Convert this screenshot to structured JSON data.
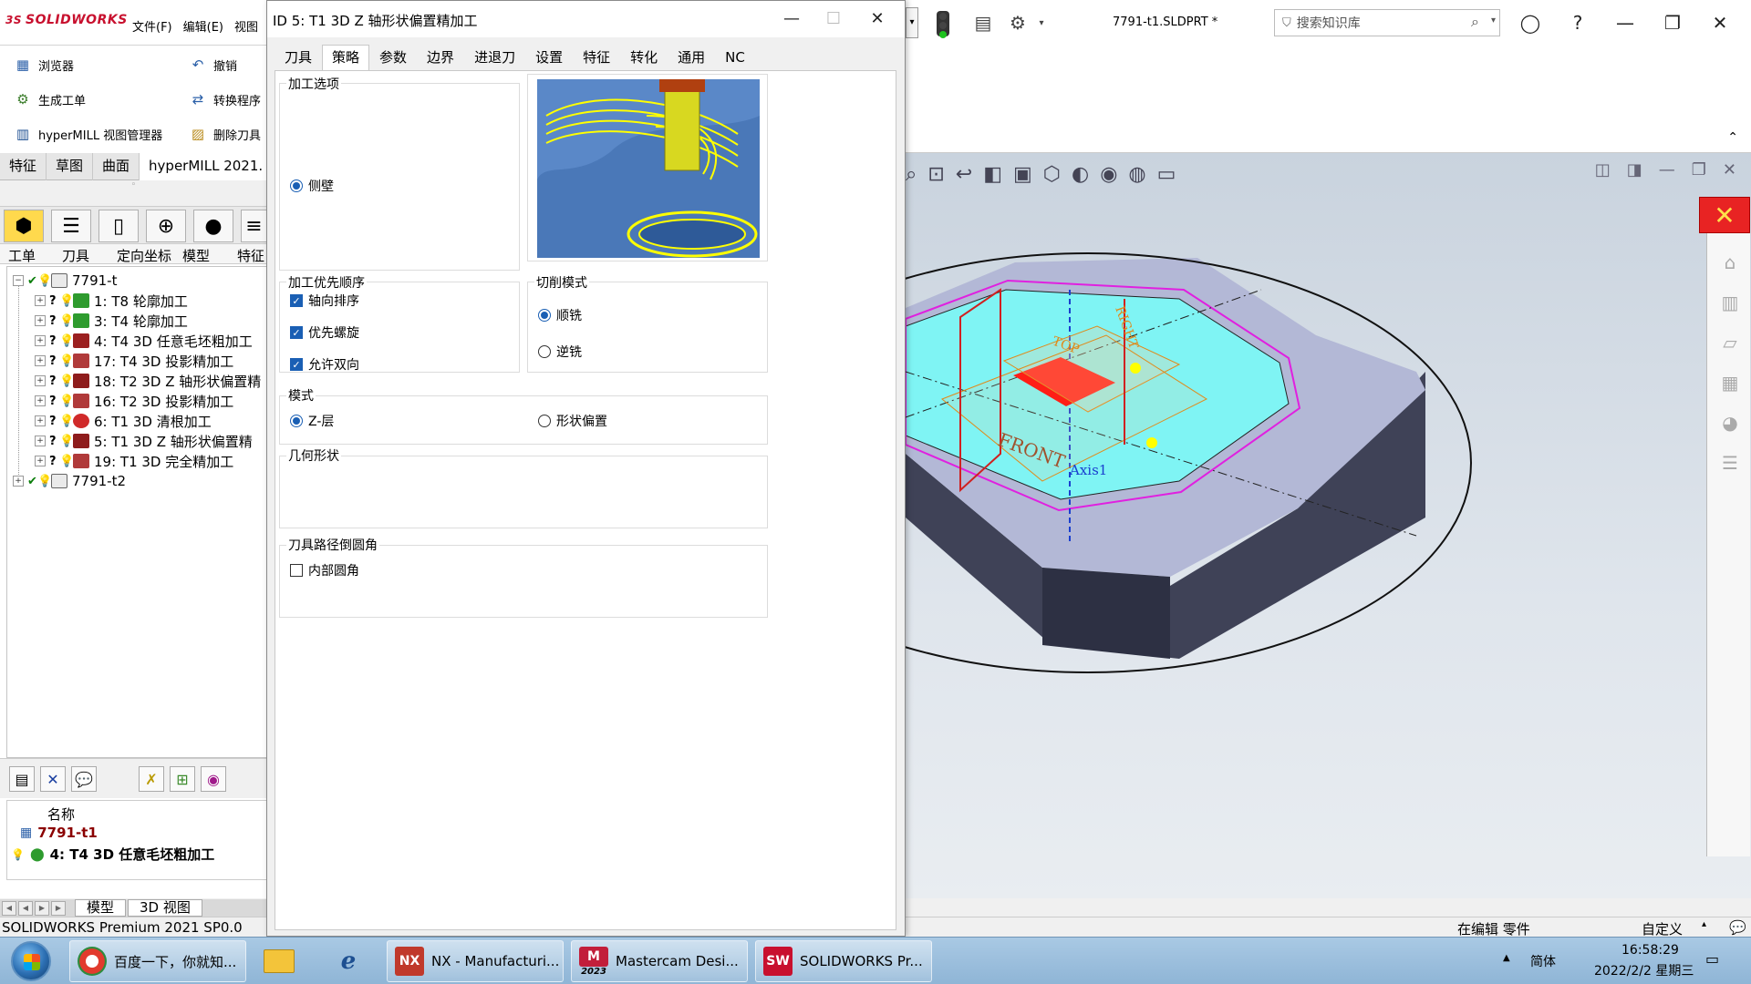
{
  "sw": {
    "logo": "SOLIDWORKS",
    "menu": [
      "文件(F)",
      "编辑(E)",
      "视图"
    ],
    "doc_title": "7791-t1.SLDPRT *",
    "search_placeholder": "搜索知识库",
    "cmd_buttons": [
      "浏览器",
      "撤销",
      "生成工单",
      "转换程序",
      "hyperMILL 视图管理器",
      "删除刀具"
    ],
    "cm_tabs": [
      "特征",
      "草图",
      "曲面",
      "hyperMILL 2021."
    ]
  },
  "hm": {
    "tab_labels": [
      "工单",
      "刀具",
      "定向坐标",
      "模型",
      "特征"
    ],
    "tree": [
      {
        "label": "7791-t",
        "level": 0,
        "expanded": true
      },
      {
        "label": "1: T8 轮廓加工",
        "level": 1
      },
      {
        "label": "3: T4 轮廓加工",
        "level": 1
      },
      {
        "label": "4: T4 3D 任意毛坯粗加工",
        "level": 1
      },
      {
        "label": "17: T4 3D 投影精加工",
        "level": 1
      },
      {
        "label": "18: T2 3D Z 轴形状偏置精",
        "level": 1
      },
      {
        "label": "16: T2 3D 投影精加工",
        "level": 1
      },
      {
        "label": "6: T1 3D 清根加工",
        "level": 1
      },
      {
        "label": "5: T1 3D Z 轴形状偏置精",
        "level": 1
      },
      {
        "label": "19: T1 3D 完全精加工",
        "level": 1
      },
      {
        "label": "7791-t2",
        "level": 0,
        "expanded": false
      }
    ],
    "name_header": "名称",
    "name_rows": [
      "7791-t1",
      "4: T4 3D 任意毛坯粗加工"
    ],
    "model_tabs": [
      "模型",
      "3D 视图"
    ]
  },
  "dialog": {
    "title": "ID 5: T1 3D Z 轴形状偏置精加工",
    "tabs": [
      "刀具",
      "策略",
      "参数",
      "边界",
      "进退刀",
      "设置",
      "特征",
      "转化",
      "通用",
      "NC"
    ],
    "active_tab": "策略",
    "group_machining_options": "加工选项",
    "opt_sidewall": "侧壁",
    "group_priority": "加工优先顺序",
    "chk_axial_sort": "轴向排序",
    "chk_prefer_spiral": "优先螺旋",
    "chk_allow_bidir": "允许双向",
    "group_cut_mode": "切削模式",
    "opt_climb": "顺铣",
    "opt_conventional": "逆铣",
    "group_mode": "模式",
    "opt_z_level": "Z-层",
    "opt_shape_offset": "形状偏置",
    "group_geometry": "几何形状",
    "group_fillet": "刀具路径倒圆角",
    "chk_inner_fillet": "内部圆角"
  },
  "viewport": {
    "front_label": "FRONT",
    "axis_label": "Axis1",
    "top_label": "TOP",
    "right_label": "RIGHT"
  },
  "status": {
    "product": "SOLIDWORKS Premium 2021 SP0.0",
    "editing": "在编辑 零件",
    "custom": "自定义"
  },
  "taskbar": {
    "apps": [
      "百度一下，你就知...",
      "NX - Manufacturi...",
      "Mastercam Desi...",
      "SOLIDWORKS Pr..."
    ],
    "mastercam_year": "2023",
    "ime": "简体",
    "time": "16:58:29",
    "date": "2022/2/2 星期三"
  },
  "colors": {
    "selection_red": "#ff0000",
    "floor_cyan": "#7ff4f4",
    "toolpath_yellow": "#ffff00",
    "boundary_magenta": "#e020e0",
    "radio_blue": "#1a5fb4"
  }
}
